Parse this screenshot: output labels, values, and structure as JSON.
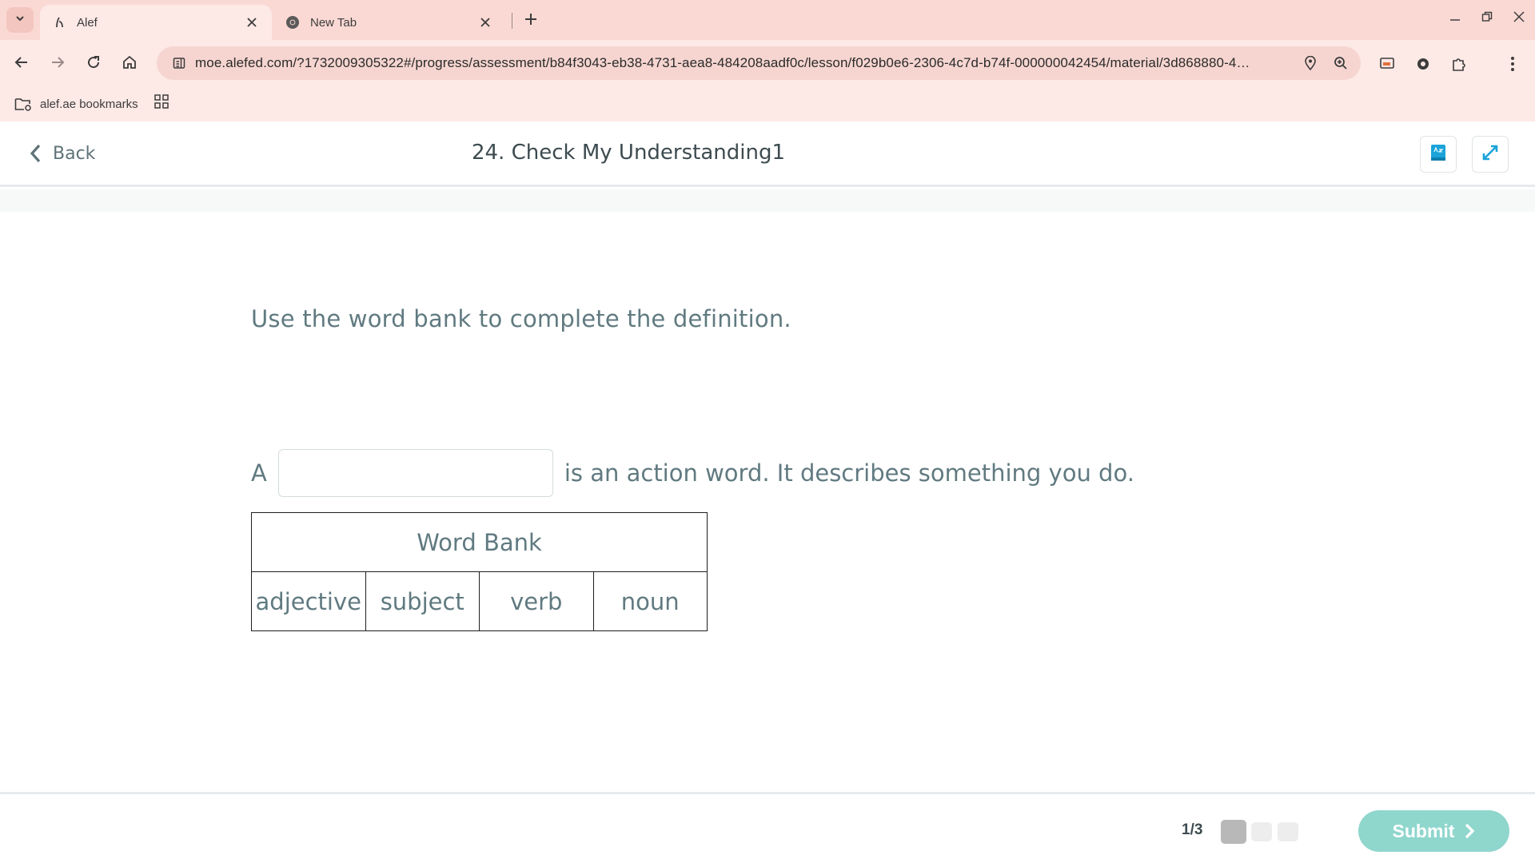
{
  "browser": {
    "tabs": [
      {
        "title": "Alef",
        "active": true
      },
      {
        "title": "New Tab",
        "active": false
      }
    ],
    "url": "moe.alefed.com/?1732009305322#/progress/assessment/b84f3043-eb38-4731-aea8-484208aadf0c/lesson/f029b0e6-2306-4c7d-b74f-000000042454/material/3d868880-4…",
    "bookmarks": [
      {
        "label": "alef.ae bookmarks"
      }
    ]
  },
  "header": {
    "back_label": "Back",
    "title": "24. Check My Understanding1"
  },
  "question": {
    "instruction": "Use the word bank to complete the definition.",
    "sentence_lead": "A",
    "blank_value": "",
    "sentence_tail": "is an action word. It describes something you do."
  },
  "word_bank": {
    "title": "Word Bank",
    "words": [
      "adjective",
      "subject",
      "verb",
      "noun"
    ]
  },
  "footer": {
    "pager_text": "1/3",
    "current_page": 1,
    "total_pages": 3,
    "submit_label": "Submit"
  },
  "colors": {
    "tab_strip": "#fad9d4",
    "toolbar": "#fde9e6",
    "text_primary": "#607a80",
    "accent_teal": "#8fd6cd",
    "icon_blue": "#1aa3d9"
  }
}
